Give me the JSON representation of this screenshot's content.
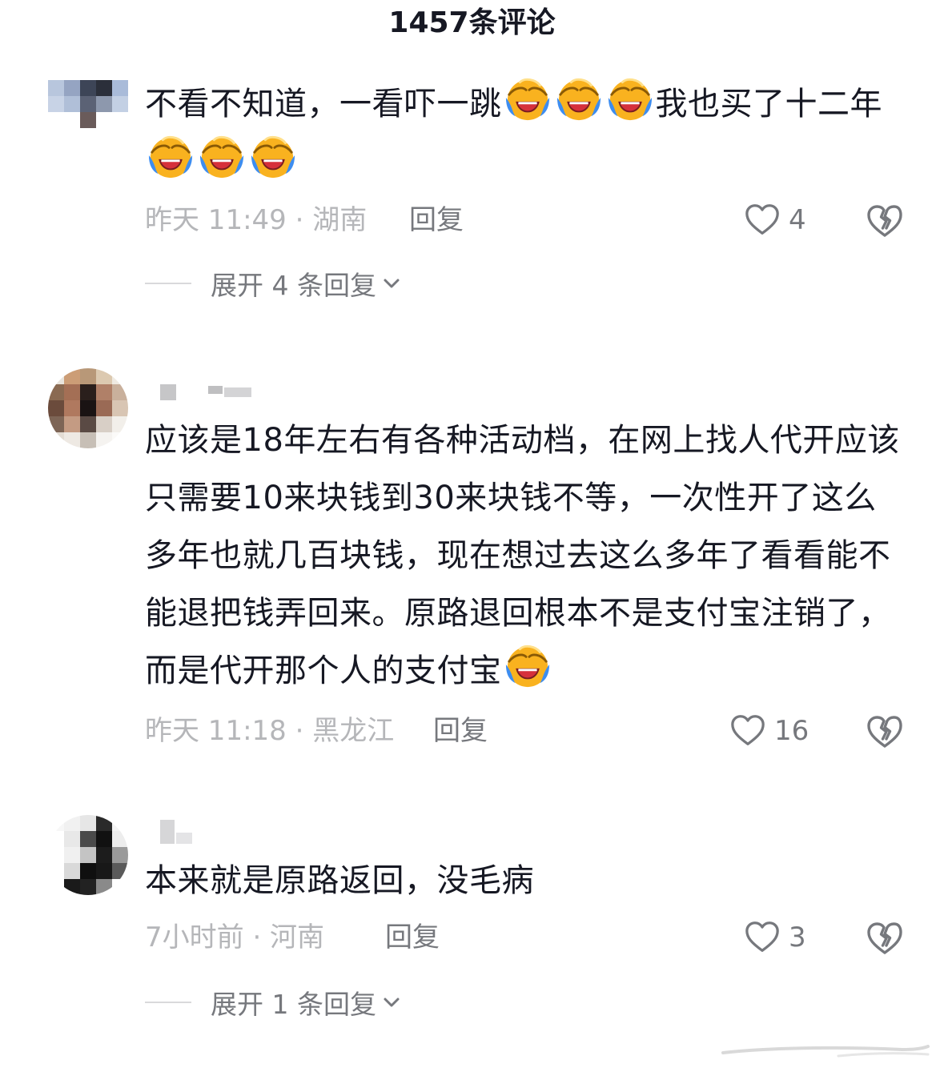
{
  "header": {
    "title": "1457条评论"
  },
  "comments": [
    {
      "segments": [
        {
          "t": "text",
          "v": "不看不知道，一看吓一跳"
        },
        {
          "t": "emoji",
          "v": "laugh-cry"
        },
        {
          "t": "emoji",
          "v": "laugh-cry"
        },
        {
          "t": "emoji",
          "v": "laugh-cry"
        },
        {
          "t": "text",
          "v": "我也买了十二年"
        },
        {
          "t": "emoji",
          "v": "laugh-cry"
        },
        {
          "t": "emoji",
          "v": "laugh-cry"
        },
        {
          "t": "emoji",
          "v": "laugh-cry"
        }
      ],
      "time": "昨天 11:49 · 湖南",
      "reply_label": "回复",
      "likes": "4",
      "expand_label": "展开 4 条回复"
    },
    {
      "segments": [
        {
          "t": "text",
          "v": "应该是18年左右有各种活动档，在网上找人代开应该只需要10来块钱到30来块钱不等，一次性开了这么多年也就几百块钱，现在想过去这么多年了看看能不能退把钱弄回来。原路退回根本不是支付宝注销了，而是代开那个人的支付宝"
        },
        {
          "t": "emoji",
          "v": "laugh-cry"
        }
      ],
      "time": "昨天 11:18 · 黑龙江",
      "reply_label": "回复",
      "likes": "16",
      "expand_label": ""
    },
    {
      "segments": [
        {
          "t": "text",
          "v": "本来就是原路返回，没毛病"
        }
      ],
      "time": "7小时前 · 河南",
      "reply_label": "回复",
      "likes": "3",
      "expand_label": "展开 1 条回复"
    }
  ],
  "colors": {
    "text": "#161823",
    "meta_gray": "#b5b6b9",
    "action_gray": "#76787d",
    "emoji_face": "#f9b21f",
    "emoji_tears": "#3d8df0",
    "emoji_mouth": "#d6303b"
  }
}
